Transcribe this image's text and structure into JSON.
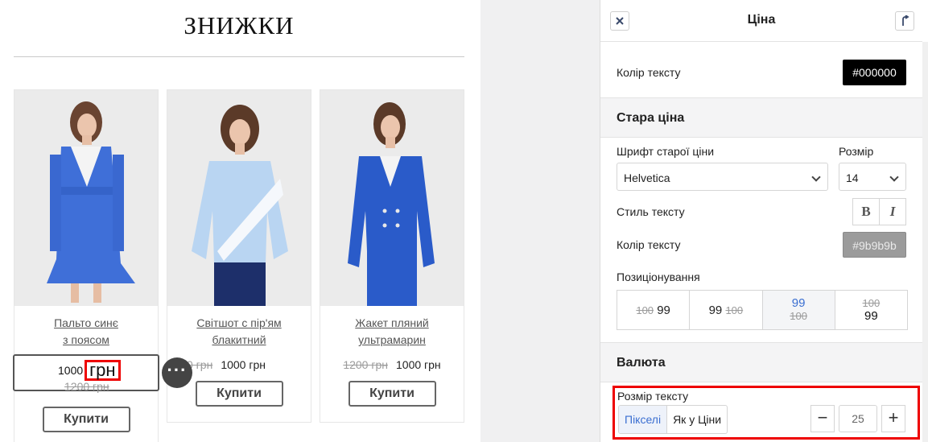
{
  "preview": {
    "heading": "ЗНИЖКИ",
    "products": [
      {
        "name_line1": "Пальто синє",
        "name_line2": "з поясом",
        "old_price": "1200 грн",
        "price": "1000 грн",
        "buy": "Купити"
      },
      {
        "name_line1": "Світшот с пір'ям",
        "name_line2": "блакитний",
        "old_price": "0 грн",
        "price": "1000 грн",
        "buy": "Купити"
      },
      {
        "name_line1": "Жакет пляний",
        "name_line2": "ультрамарин",
        "old_price": "1200 грн",
        "price": "1000 грн",
        "buy": "Купити"
      }
    ],
    "selected_price": {
      "amount": "1000",
      "currency": "грн",
      "old": "1200 грн"
    },
    "more_icon": "more-dots-icon"
  },
  "panel": {
    "title": "Ціна",
    "close_icon": "close-icon",
    "pin_icon": "pin-arrow-icon",
    "text_color_label": "Колір тексту",
    "text_color_value": "#000000",
    "old_price_section": "Стара ціна",
    "old_font_label": "Шрифт старої ціни",
    "old_font_value": "Helvetica",
    "size_label": "Розмір",
    "size_value": "14",
    "text_style_label": "Стиль тексту",
    "bold_label": "B",
    "italic_label": "I",
    "old_color_label": "Колір тексту",
    "old_color_value": "#9b9b9b",
    "positioning_label": "Позиціонування",
    "positions": [
      {
        "old": "100",
        "new": "99"
      },
      {
        "old": "100",
        "new": "99"
      },
      {
        "old": "100",
        "new": "99"
      },
      {
        "old": "100",
        "new": "99"
      }
    ],
    "currency_section": "Валюта",
    "text_size_label": "Розмір тексту",
    "unit_pixels": "Пікселі",
    "unit_same": "Як у Ціни",
    "size_step_value": "25",
    "minus": "−",
    "plus": "+"
  },
  "colors": {
    "accent": "#3b6fd1",
    "highlight": "#e00000",
    "old_price": "#9b9b9b"
  }
}
